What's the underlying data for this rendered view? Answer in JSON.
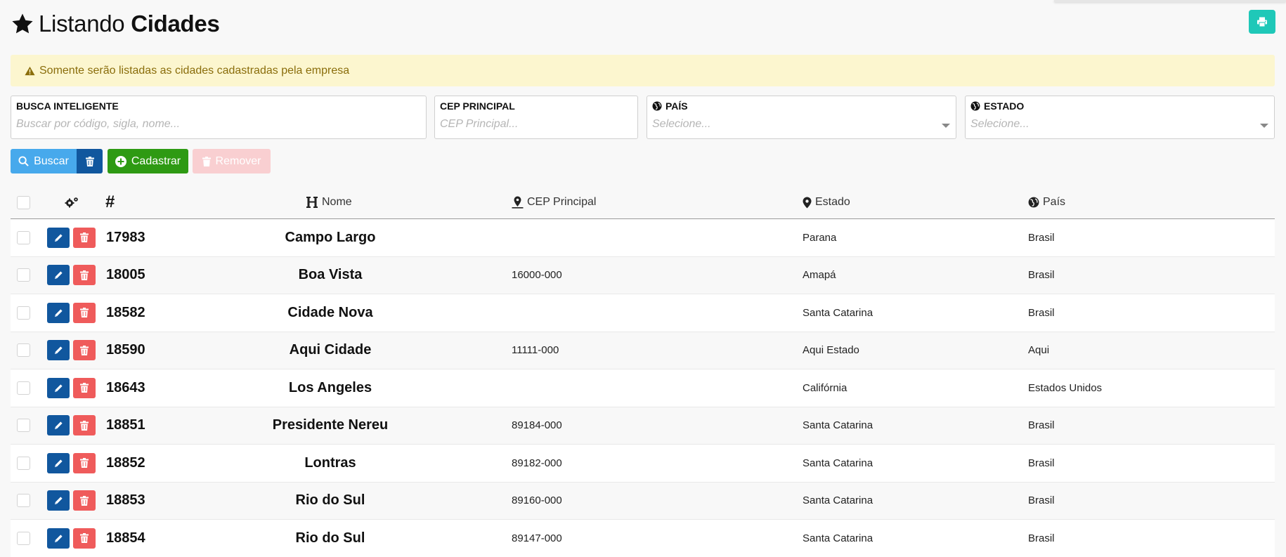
{
  "header": {
    "title_light": "Listando",
    "title_bold": "Cidades",
    "star_icon": "star-icon",
    "print_icon": "print-icon"
  },
  "alert": {
    "icon": "warning-icon",
    "text": "Somente serão listadas as cidades cadastradas pela empresa"
  },
  "filters": {
    "busca": {
      "label": "BUSCA INTELIGENTE",
      "placeholder": "Buscar por código, sigla, nome...",
      "value": ""
    },
    "cep": {
      "label": "CEP PRINCIPAL",
      "placeholder": "CEP Principal...",
      "value": ""
    },
    "pais": {
      "label": "PAÍS",
      "icon": "globe-icon",
      "selected": "Selecione..."
    },
    "estado": {
      "label": "ESTADO",
      "icon": "globe-icon",
      "selected": "Selecione..."
    }
  },
  "toolbar": {
    "buscar_label": "Buscar",
    "cadastrar_label": "Cadastrar",
    "remover_label": "Remover"
  },
  "table": {
    "columns": {
      "actions_icon": "cogs-icon",
      "id": "#",
      "nome": "Nome",
      "cep": "CEP Principal",
      "estado": "Estado",
      "pais": "País"
    },
    "rows": [
      {
        "id": "17983",
        "nome": "Campo Largo",
        "cep": "",
        "estado": "Parana",
        "pais": "Brasil"
      },
      {
        "id": "18005",
        "nome": "Boa Vista",
        "cep": "16000-000",
        "estado": "Amapá",
        "pais": "Brasil"
      },
      {
        "id": "18582",
        "nome": "Cidade Nova",
        "cep": "",
        "estado": "Santa Catarina",
        "pais": "Brasil"
      },
      {
        "id": "18590",
        "nome": "Aqui Cidade",
        "cep": "11111-000",
        "estado": "Aqui Estado",
        "pais": "Aqui"
      },
      {
        "id": "18643",
        "nome": "Los Angeles",
        "cep": "",
        "estado": "Califórnia",
        "pais": "Estados Unidos"
      },
      {
        "id": "18851",
        "nome": "Presidente Nereu",
        "cep": "89184-000",
        "estado": "Santa Catarina",
        "pais": "Brasil"
      },
      {
        "id": "18852",
        "nome": "Lontras",
        "cep": "89182-000",
        "estado": "Santa Catarina",
        "pais": "Brasil"
      },
      {
        "id": "18853",
        "nome": "Rio do Sul",
        "cep": "89160-000",
        "estado": "Santa Catarina",
        "pais": "Brasil"
      },
      {
        "id": "18854",
        "nome": "Rio do Sul",
        "cep": "89147-000",
        "estado": "Santa Catarina",
        "pais": "Brasil"
      }
    ]
  },
  "colors": {
    "print": "#1fc8b8",
    "buscar": "#47a9ec",
    "clear": "#11579e",
    "cadastrar": "#2e9a13",
    "remover_disabled": "#f9cfd1",
    "edit": "#11579e",
    "delete": "#ef5b5b",
    "alert_bg": "#fcf6cf",
    "alert_text": "#8a6d0b"
  }
}
